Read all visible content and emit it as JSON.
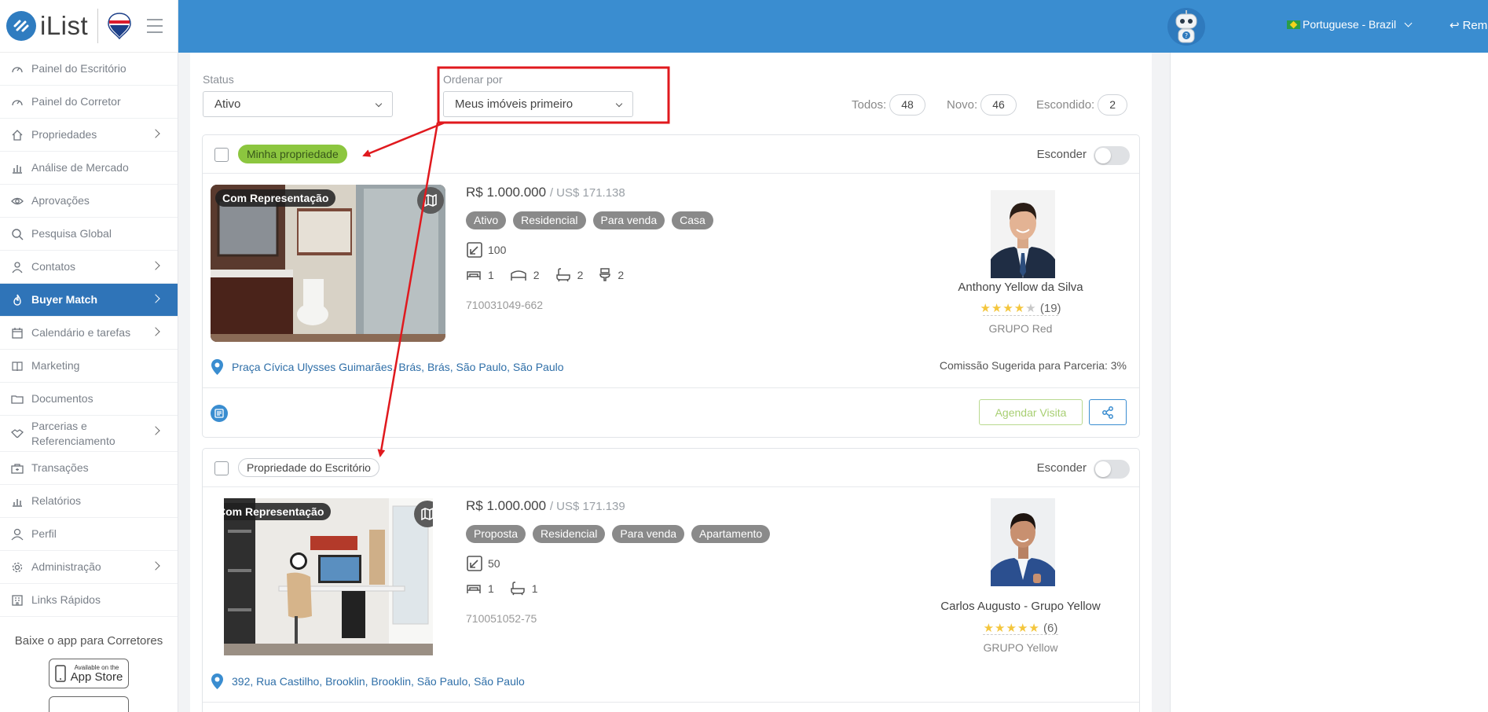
{
  "brand": {
    "logo_text": "iList"
  },
  "sidebar": {
    "items": [
      {
        "label": "Painel do Escritório",
        "icon": "gauge-icon"
      },
      {
        "label": "Painel do Corretor",
        "icon": "gauge-icon"
      },
      {
        "label": "Propriedades",
        "icon": "home-icon",
        "has_children": true
      },
      {
        "label": "Análise de Mercado",
        "icon": "bar-chart-icon"
      },
      {
        "label": "Aprovações",
        "icon": "eye-icon"
      },
      {
        "label": "Pesquisa Global",
        "icon": "search-icon"
      },
      {
        "label": "Contatos",
        "icon": "contacts-icon",
        "has_children": true
      },
      {
        "label": "Buyer Match",
        "icon": "fire-icon",
        "has_children": true,
        "active": true
      },
      {
        "label": "Calendário e tarefas",
        "icon": "calendar-icon",
        "has_children": true
      },
      {
        "label": "Marketing",
        "icon": "book-icon"
      },
      {
        "label": "Documentos",
        "icon": "folder-icon"
      },
      {
        "label": "Parcerias e Referenciamento",
        "icon": "handshake-icon",
        "has_children": true
      },
      {
        "label": "Transações",
        "icon": "briefcase-icon"
      },
      {
        "label": "Relatórios",
        "icon": "report-icon"
      },
      {
        "label": "Perfil",
        "icon": "user-icon"
      },
      {
        "label": "Administração",
        "icon": "gear-icon",
        "has_children": true
      },
      {
        "label": "Links Rápidos",
        "icon": "building-icon"
      }
    ],
    "app_promo": "Baixe o app para Corretores",
    "app_store": {
      "small": "Available on the",
      "big": "App Store"
    }
  },
  "header": {
    "language": "Portuguese - Brazil",
    "user": "Remax\\anthony@remax.com.br",
    "bg_color": "#3a8dd0"
  },
  "filters": {
    "status_label": "Status",
    "status_value": "Ativo",
    "order_label": "Ordenar por",
    "order_value": "Meus imóveis primeiro",
    "counts": [
      {
        "label": "Todos:",
        "value": "48"
      },
      {
        "label": "Novo:",
        "value": "46"
      },
      {
        "label": "Escondido:",
        "value": "2"
      }
    ]
  },
  "listings": [
    {
      "tag": "Minha propriedade",
      "hide_label": "Esconder",
      "badge": "Com Representação",
      "price": "R$ 1.000.000",
      "price_usd": "/ US$ 171.138",
      "chips": [
        "Ativo",
        "Residencial",
        "Para venda",
        "Casa"
      ],
      "area": "100",
      "features": [
        "1",
        "2",
        "2",
        "2"
      ],
      "ref": "710031049-662",
      "agent_name": "Anthony Yellow da Silva",
      "rating": 4,
      "rating_count": "(19)",
      "agent_group": "GRUPO Red",
      "address": "Praça Cívica Ulysses Guimarães, Brás, Brás, São Paulo, São Paulo",
      "commission": "Comissão Sugerida para Parceria: 3%",
      "visit_label": "Agendar Visita"
    },
    {
      "tag": "Propriedade do Escritório",
      "hide_label": "Esconder",
      "badge": "Com Representação",
      "price": "R$ 1.000.000",
      "price_usd": "/ US$ 171.139",
      "chips": [
        "Proposta",
        "Residencial",
        "Para venda",
        "Apartamento"
      ],
      "area": "50",
      "features": [
        "1",
        "1"
      ],
      "ref": "710051052-75",
      "agent_name": "Carlos Augusto - Grupo Yellow",
      "rating": 5,
      "rating_count": "(6)",
      "agent_group": "GRUPO Yellow",
      "address": "392, Rua Castilho, Brooklin, Brooklin, São Paulo, São Paulo"
    }
  ],
  "colors": {
    "accent": "#3a8dd0",
    "mine_tag": "#8cc63f",
    "annotation": "#e0191e"
  }
}
